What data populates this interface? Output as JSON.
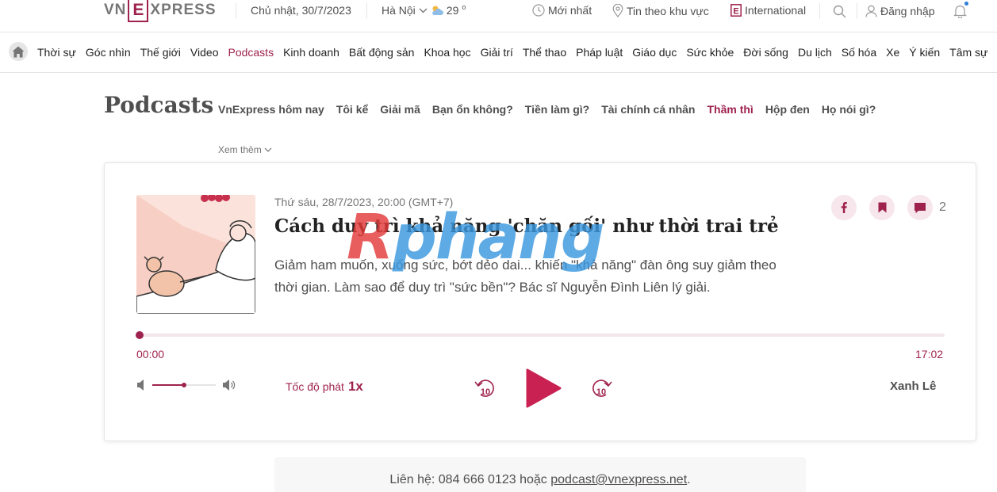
{
  "header": {
    "logo_text": "VNEXPRESS",
    "date": "Chủ nhật, 30/7/2023",
    "location": "Hà Nội",
    "temperature": "29",
    "temp_unit": "o",
    "latest": "Mới nhất",
    "regional": "Tin theo khu vực",
    "international": "International",
    "login": "Đăng nhập"
  },
  "nav": {
    "items": [
      "Thời sự",
      "Góc nhìn",
      "Thế giới",
      "Video",
      "Podcasts",
      "Kinh doanh",
      "Bất động sản",
      "Khoa học",
      "Giải trí",
      "Thể thao",
      "Pháp luật",
      "Giáo dục",
      "Sức khỏe",
      "Đời sống",
      "Du lịch",
      "Số hóa",
      "Xe",
      "Ý kiến",
      "Tâm sự"
    ],
    "active": "Podcasts"
  },
  "podcasts": {
    "title": "Podcasts",
    "subnav": [
      "VnExpress hôm nay",
      "Tôi kể",
      "Giải mã",
      "Bạn ổn không?",
      "Tiền làm gì?",
      "Tài chính cá nhân",
      "Thầm thì",
      "Hộp đen",
      "Họ nói gì?"
    ],
    "active_sub": "Thầm thì",
    "more": "Xem thêm"
  },
  "episode": {
    "date": "Thứ sáu, 28/7/2023, 20:00 (GMT+7)",
    "title": "Cách duy trì khả năng 'chăn gối' như thời trai trẻ",
    "lead": "Giảm ham muốn, xuống sức, bớt dẻo dai... khiến \"khả năng\" đàn ông suy giảm theo thời gian. Làm sao để duy trì \"sức bền\"? Bác sĩ Nguyễn Đình Liên lý giải.",
    "comment_count": "2",
    "author": "Xanh Lê"
  },
  "player": {
    "current_time": "00:00",
    "total_time": "17:02",
    "progress": 0,
    "volume": 0.5,
    "speed_label": "Tốc độ phát",
    "speed_value": "1x",
    "rewind": "10",
    "forward": "10"
  },
  "contact": {
    "prefix": "Liên hệ: 084 666 0123 hoặc",
    "email": "podcast@vnexpress.net",
    "suffix": "."
  },
  "watermark": {
    "part1": "R",
    "part2": "phang"
  },
  "colors": {
    "brand": "#9f224e",
    "play": "#c82152",
    "text": "#222222",
    "muted": "#757575"
  }
}
